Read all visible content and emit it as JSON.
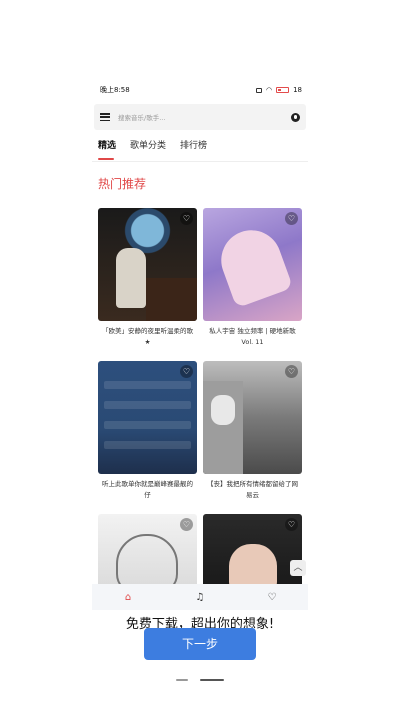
{
  "status": {
    "time": "晚上8:58",
    "battery": "18"
  },
  "search": {
    "placeholder": "搜索音乐/歌手..."
  },
  "tabs": [
    {
      "label": "精选"
    },
    {
      "label": "歌单分类"
    },
    {
      "label": "排行榜"
    }
  ],
  "section": {
    "title": "热门推荐"
  },
  "cards": [
    {
      "caption": "「欧美」安静的夜里听温柔的歌★"
    },
    {
      "caption": "私人宇宙 独立频率 | 硬地新歌 Vol. 11"
    },
    {
      "caption": "听上此歌单你就是巅峰赛最靓的仔"
    },
    {
      "caption": "【丧】我把所有情绪都留给了网易云"
    },
    {
      "caption": ""
    },
    {
      "caption": ""
    }
  ],
  "bottom_nav": {
    "items": [
      "home-icon",
      "playlist-icon",
      "heart-icon"
    ]
  },
  "promo": {
    "text": "免费下载，超出你的想象!"
  },
  "cta": {
    "label": "下一步"
  },
  "colors": {
    "accent": "#e04848",
    "button": "#3d7de0"
  }
}
